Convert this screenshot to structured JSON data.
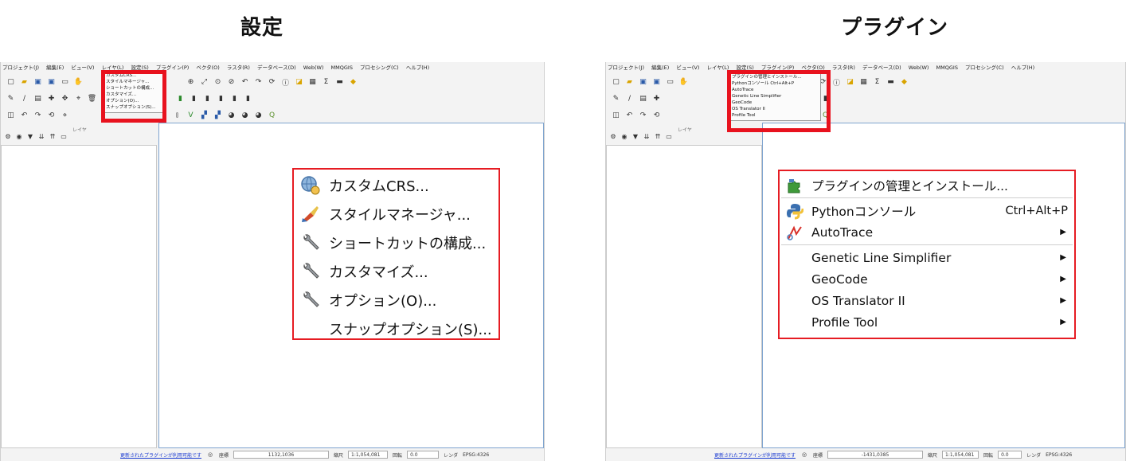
{
  "titles": {
    "left": "設定",
    "right": "プラグイン"
  },
  "menubar": [
    "プロジェクト(J)",
    "編集(E)",
    "ビュー(V)",
    "レイヤ(L)",
    "設定(S)",
    "プラグイン(P)",
    "ベクタ(O)",
    "ラスタ(R)",
    "データベース(D)",
    "Web(W)",
    "MMQGIS",
    "プロセシング(C)",
    "ヘルプ(H)"
  ],
  "layers_panel_title": "レイヤ",
  "left_mini_menu": [
    "カスタムCRS...",
    "スタイルマネージャ...",
    "ショートカットの構成...",
    "カスタマイズ...",
    "オプション(O)...",
    "スナップオプション(S)..."
  ],
  "right_mini_menu": [
    "プラグインの管理とインストール...",
    "Pythonコンソール  Ctrl+Alt+P",
    "AutoTrace",
    "Genetic Line Simplifier",
    "GeoCode",
    "OS Translator II",
    "Profile Tool"
  ],
  "settings_menu": {
    "items": [
      {
        "label": "カスタムCRS...",
        "icon": "globe-gear-icon"
      },
      {
        "label": "スタイルマネージャ...",
        "icon": "brush-icon"
      },
      {
        "label": "ショートカットの構成...",
        "icon": "wrench-icon"
      },
      {
        "label": "カスタマイズ...",
        "icon": "wrench-icon"
      },
      {
        "label": "オプション(O)...",
        "icon": "wrench-icon"
      },
      {
        "label": "スナップオプション(S)...",
        "icon": ""
      }
    ]
  },
  "plugins_menu": {
    "items": [
      {
        "label": "プラグインの管理とインストール...",
        "icon": "puzzle-icon",
        "shortcut": "",
        "submenu": false
      },
      {
        "label": "Pythonコンソール",
        "icon": "python-icon",
        "shortcut": "Ctrl+Alt+P",
        "submenu": false
      },
      {
        "label": "AutoTrace",
        "icon": "autotrace-icon",
        "shortcut": "",
        "submenu": true
      },
      {
        "label": "Genetic Line Simplifier",
        "icon": "",
        "shortcut": "",
        "submenu": true
      },
      {
        "label": "GeoCode",
        "icon": "",
        "shortcut": "",
        "submenu": true
      },
      {
        "label": "OS Translator II",
        "icon": "",
        "shortcut": "",
        "submenu": true
      },
      {
        "label": "Profile Tool",
        "icon": "",
        "shortcut": "",
        "submenu": true
      }
    ]
  },
  "statusbar_left": {
    "link": "更新されたプラグインが利用可能です",
    "coord_label": "座標",
    "coord": "1132,1036",
    "scale_label": "縮尺",
    "scale": "1:1,054,081",
    "rotation_label": "回転",
    "rotation": "0.0",
    "render_label": "レンダ",
    "crs": "EPSG:4326"
  },
  "statusbar_right": {
    "link": "更新されたプラグインが利用可能です",
    "coord_label": "座標",
    "coord": "-1431,0385",
    "scale_label": "縮尺",
    "scale": "1:1,054,081",
    "rotation_label": "回転",
    "rotation": "0.0",
    "render_label": "レンダ",
    "crs": "EPSG:4326"
  },
  "colors": {
    "highlight": "#e8121e",
    "link": "#1a3ad1",
    "canvas_border": "#7fa4cf"
  }
}
